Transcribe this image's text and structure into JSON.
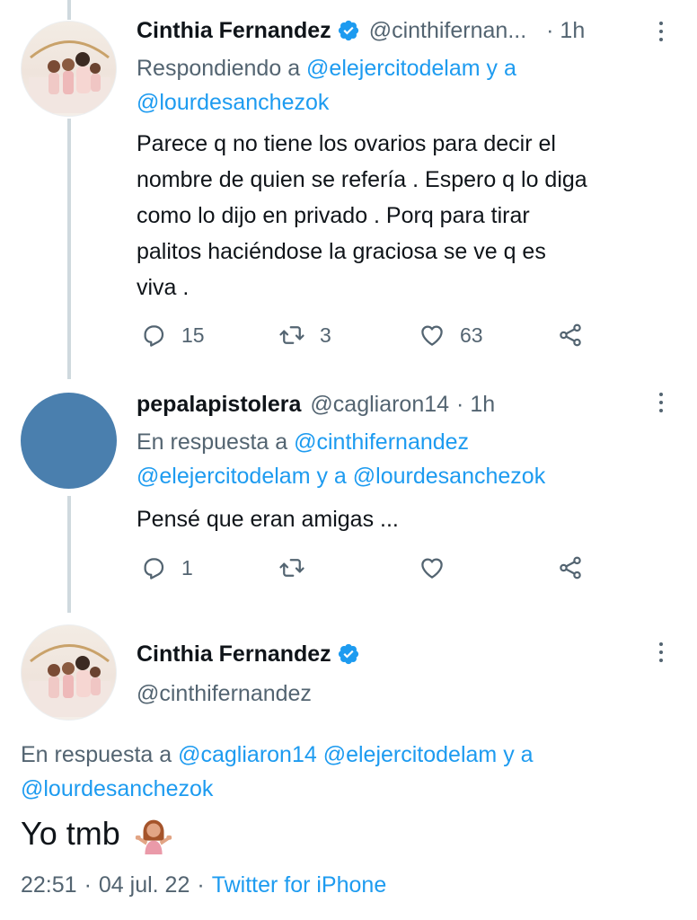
{
  "tweet1": {
    "name": "Cinthia Fernandez",
    "handle": "@cinthifernan...",
    "time": "· 1h",
    "reply_prefix": "Respondiendo a",
    "reply_user1": "@elejercitodelam",
    "reply_joiner": "y a",
    "reply_user2": "@lourdesanchezok",
    "text_lines": [
      "Parece q no tiene los ovarios para decir el",
      "nombre de quien se refería . Espero q lo diga",
      "como lo dijo en privado . Porq para tirar",
      "palitos haciéndose la graciosa se ve q es",
      "viva ."
    ],
    "replies": "15",
    "retweets": "3",
    "likes": "63"
  },
  "tweet2": {
    "name": "pepalapistolera",
    "handle": "@cagliaron14",
    "time": "· 1h",
    "reply_prefix": "En respuesta a",
    "reply_user1": "@cinthifernandez",
    "reply_user2": "@elejercitodelam",
    "reply_joiner": "y a",
    "reply_user3": "@lourdesanchezok",
    "text": "Pensé que eran amigas ...",
    "replies": "1"
  },
  "tweet3": {
    "name": "Cinthia Fernandez",
    "handle": "@cinthifernandez",
    "reply_prefix": "En respuesta a",
    "reply_user1": "@cagliaron14",
    "reply_user2": "@elejercitodelam",
    "reply_joiner": "y a",
    "reply_user3": "@lourdesanchezok",
    "text": "Yo tmb",
    "time": "22:51",
    "date": "04 jul. 22",
    "separator": "·",
    "source": "Twitter for iPhone"
  },
  "colors": {
    "link": "#1d9bf0",
    "muted": "#536471",
    "text": "#0f1419",
    "thread_line": "#cfd9de",
    "avatar_blue": "#4a7fae"
  },
  "icons": [
    "verified-badge-icon",
    "more-options-icon",
    "reply-icon",
    "retweet-icon",
    "like-icon",
    "share-icon",
    "person-shrugging-emoji"
  ]
}
